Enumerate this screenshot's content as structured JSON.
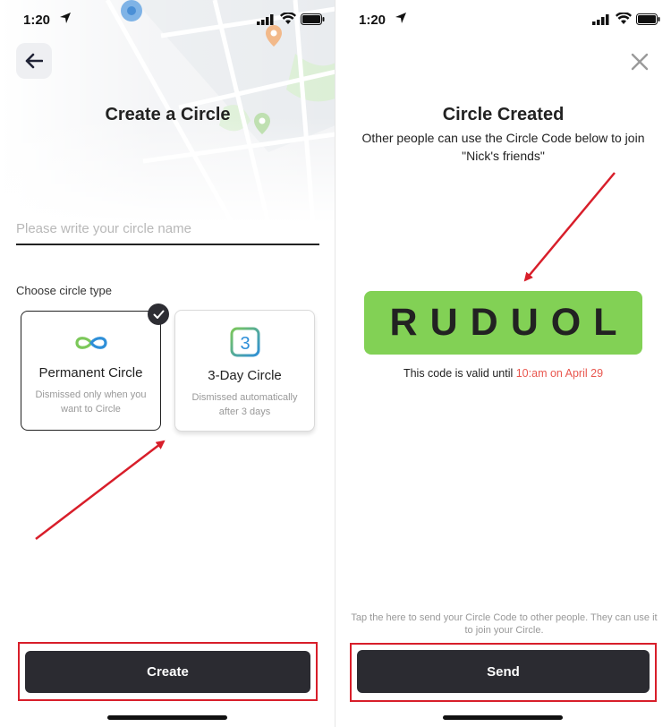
{
  "status_bar_left": {
    "time": "1:20"
  },
  "status_bar_right": {
    "time": "1:20"
  },
  "create_screen": {
    "title": "Create a Circle",
    "name_placeholder": "Please write your circle name",
    "choose_type_label": "Choose circle type",
    "types": [
      {
        "title": "Permanent Circle",
        "description": "Dismissed only when you want to Circle",
        "icon": "infinity-icon",
        "selected": true
      },
      {
        "title": "3-Day Circle",
        "description": "Dismissed automatically after 3 days",
        "icon": "three-day-icon",
        "icon_text": "3",
        "selected": false
      }
    ],
    "create_button": "Create"
  },
  "created_screen": {
    "title": "Circle Created",
    "subtitle": "Other people can use the Circle Code below to join \"Nick's friends\"",
    "circle_code": "RUDUOL",
    "valid_prefix": "This code is valid until ",
    "valid_until": "10:am on April 29",
    "hint": "Tap the here to send your Circle Code to other people. They can use it to join your Circle.",
    "send_button": "Send"
  },
  "colors": {
    "code_bg": "#82d155",
    "button_bg": "#2b2b31",
    "highlight_red": "#d81e2a",
    "accent_red_text": "#e9574f",
    "infinity_green": "#7cc85a",
    "infinity_blue": "#2e8fd8"
  }
}
